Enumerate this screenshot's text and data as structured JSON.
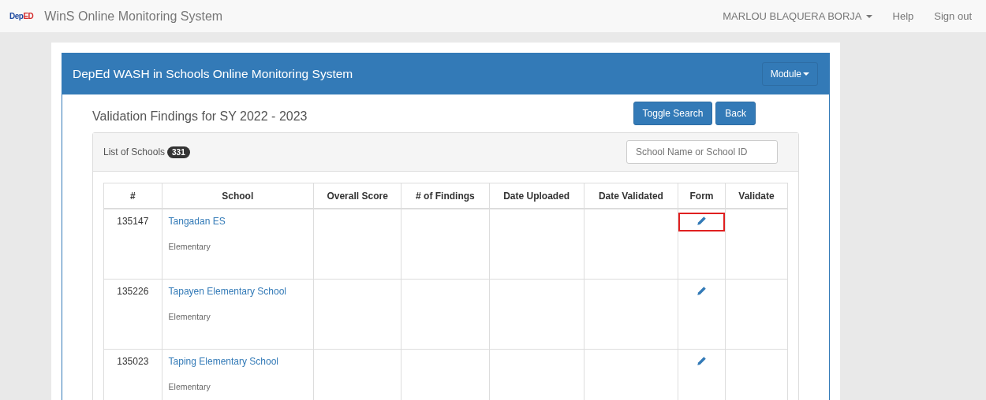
{
  "navbar": {
    "logo": {
      "part1": "Dep",
      "part2": "ED"
    },
    "brand": "WinS Online Monitoring System",
    "user": "MARLOU BLAQUERA BORJA",
    "links": [
      "Help",
      "Sign out"
    ]
  },
  "panel": {
    "title": "DepEd WASH in Schools Online Monitoring System",
    "module_button": "Module"
  },
  "page_title": "Validation Findings for SY 2022 - 2023",
  "buttons": [
    "Toggle Search",
    "Back"
  ],
  "list": {
    "label": "List of Schools",
    "count": "331",
    "search": {
      "placeholder": "School Name or School ID"
    }
  },
  "table": {
    "columns": [
      "#",
      "School",
      "Overall Score",
      "# of Findings",
      "Date Uploaded",
      "Date Validated",
      "Form",
      "Validate"
    ],
    "rows": [
      {
        "id": "135147",
        "school": "Tangadan ES",
        "level": "Elementary",
        "highlighted": true
      },
      {
        "id": "135226",
        "school": "Tapayen Elementary School",
        "level": "Elementary",
        "highlighted": false
      },
      {
        "id": "135023",
        "school": "Taping Elementary School",
        "level": "Elementary",
        "highlighted": false
      }
    ]
  }
}
